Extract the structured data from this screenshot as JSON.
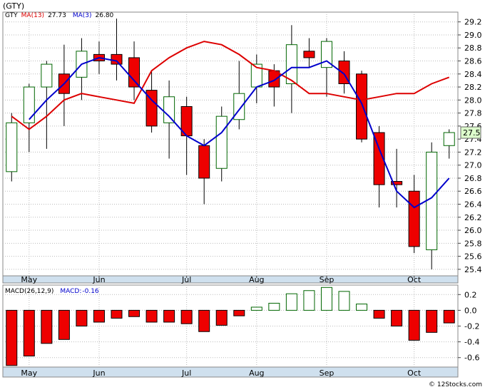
{
  "title": "(GTY)",
  "watermark": "© 12Stocks.com",
  "chart_data": [
    {
      "type": "candlestick",
      "legend": [
        {
          "label": "GTY",
          "color": "#000000"
        },
        {
          "label": "MA(13)",
          "value": "27.73",
          "color": "#dd0000"
        },
        {
          "label": "MA(3)",
          "value": "26.80",
          "color": "#0000cc"
        }
      ],
      "last_price_label": "27.5",
      "y_ticks": [
        "29.2",
        "29.0",
        "28.8",
        "28.6",
        "28.4",
        "28.2",
        "28.0",
        "27.8",
        "27.6",
        "27.4",
        "27.2",
        "27.0",
        "26.8",
        "26.6",
        "26.4",
        "26.2",
        "26.0",
        "25.8",
        "25.6",
        "25.4"
      ],
      "ylim": [
        25.3,
        29.35
      ],
      "x_ticks": [
        "May",
        "Jun",
        "Jul",
        "Aug",
        "Sep",
        "Oct"
      ],
      "x_tick_index": [
        1,
        5,
        10,
        14,
        18,
        23
      ],
      "grid": true,
      "candles": [
        {
          "o": 26.9,
          "h": 27.8,
          "l": 26.75,
          "c": 27.65
        },
        {
          "o": 27.65,
          "h": 28.25,
          "l": 27.2,
          "c": 28.2
        },
        {
          "o": 28.2,
          "h": 28.6,
          "l": 27.25,
          "c": 28.55
        },
        {
          "o": 28.4,
          "h": 28.85,
          "l": 27.6,
          "c": 28.1
        },
        {
          "o": 28.35,
          "h": 28.95,
          "l": 28.0,
          "c": 28.75
        },
        {
          "o": 28.7,
          "h": 28.9,
          "l": 28.4,
          "c": 28.6
        },
        {
          "o": 28.7,
          "h": 29.25,
          "l": 28.3,
          "c": 28.55
        },
        {
          "o": 28.65,
          "h": 28.9,
          "l": 28.0,
          "c": 28.2
        },
        {
          "o": 28.15,
          "h": 28.45,
          "l": 27.5,
          "c": 27.6
        },
        {
          "o": 27.65,
          "h": 28.3,
          "l": 27.1,
          "c": 28.05
        },
        {
          "o": 27.9,
          "h": 28.05,
          "l": 26.85,
          "c": 27.45
        },
        {
          "o": 27.3,
          "h": 27.4,
          "l": 26.4,
          "c": 26.8
        },
        {
          "o": 26.95,
          "h": 27.9,
          "l": 26.75,
          "c": 27.75
        },
        {
          "o": 27.7,
          "h": 28.6,
          "l": 27.55,
          "c": 28.1
        },
        {
          "o": 28.2,
          "h": 28.7,
          "l": 27.95,
          "c": 28.55
        },
        {
          "o": 28.45,
          "h": 28.55,
          "l": 27.9,
          "c": 28.2
        },
        {
          "o": 28.25,
          "h": 29.15,
          "l": 27.8,
          "c": 28.85
        },
        {
          "o": 28.75,
          "h": 28.95,
          "l": 28.5,
          "c": 28.65
        },
        {
          "o": 28.5,
          "h": 28.95,
          "l": 28.05,
          "c": 28.9
        },
        {
          "o": 28.6,
          "h": 28.75,
          "l": 28.1,
          "c": 28.25
        },
        {
          "o": 28.4,
          "h": 28.45,
          "l": 27.35,
          "c": 27.4
        },
        {
          "o": 27.5,
          "h": 27.6,
          "l": 26.35,
          "c": 26.7
        },
        {
          "o": 26.75,
          "h": 27.25,
          "l": 26.35,
          "c": 26.7
        },
        {
          "o": 26.6,
          "h": 26.85,
          "l": 25.65,
          "c": 25.75
        },
        {
          "o": 25.7,
          "h": 27.35,
          "l": 25.4,
          "c": 27.2
        },
        {
          "o": 27.3,
          "h": 27.55,
          "l": 27.1,
          "c": 27.5
        }
      ],
      "ma13": [
        27.75,
        27.55,
        27.75,
        28.0,
        28.1,
        28.05,
        28.0,
        27.95,
        28.45,
        28.65,
        28.8,
        28.9,
        28.85,
        28.7,
        28.5,
        28.45,
        28.3,
        28.1,
        28.1,
        28.05,
        28.0,
        28.05,
        28.1,
        28.1,
        28.25,
        28.35
      ],
      "ma13_start": 0,
      "ma3": [
        27.7,
        28.0,
        28.25,
        28.55,
        28.65,
        28.6,
        28.3,
        28.0,
        27.75,
        27.45,
        27.3,
        27.5,
        27.85,
        28.2,
        28.3,
        28.5,
        28.5,
        28.6,
        28.4,
        27.95,
        27.25,
        26.6,
        26.35,
        26.5,
        26.8
      ],
      "ma3_start": 1
    },
    {
      "type": "bar",
      "legend": [
        {
          "label": "MACD(26,12,9)",
          "color": "#000000"
        },
        {
          "label": "MACD:",
          "value": "-0.16",
          "color": "#0000cc"
        }
      ],
      "y_ticks": [
        "0.2",
        "0.0",
        "-0.2",
        "-0.4",
        "-0.6"
      ],
      "ylim": [
        -0.72,
        0.32
      ],
      "x_ticks": [
        "May",
        "Jun",
        "Jul",
        "Aug",
        "Sep",
        "Oct"
      ],
      "x_tick_index": [
        1,
        5,
        10,
        14,
        18,
        23
      ],
      "values": [
        -0.7,
        -0.58,
        -0.42,
        -0.37,
        -0.2,
        -0.15,
        -0.1,
        -0.08,
        -0.15,
        -0.15,
        -0.17,
        -0.27,
        -0.19,
        -0.07,
        0.04,
        0.09,
        0.21,
        0.25,
        0.29,
        0.24,
        0.08,
        -0.1,
        -0.2,
        -0.38,
        -0.28,
        -0.16
      ]
    }
  ]
}
